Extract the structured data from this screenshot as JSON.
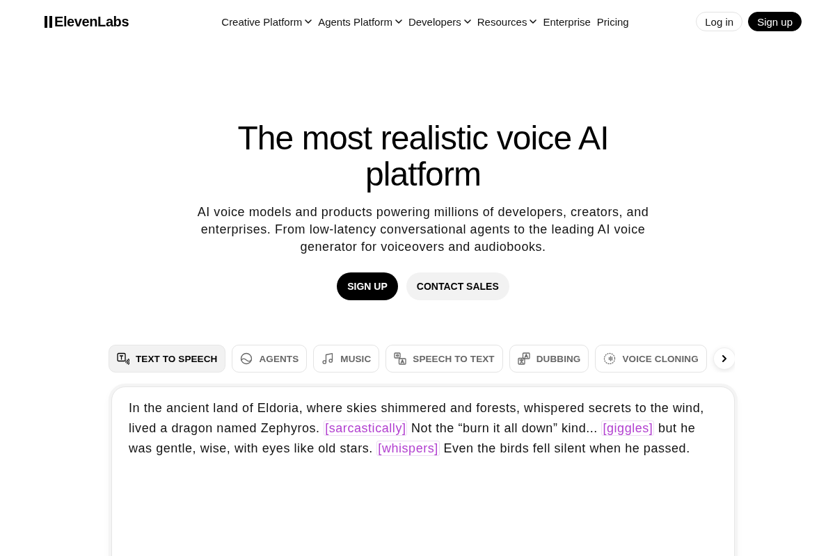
{
  "header": {
    "logo": "ElevenLabs",
    "nav": [
      {
        "label": "Creative Platform",
        "has_menu": true
      },
      {
        "label": "Agents Platform",
        "has_menu": true
      },
      {
        "label": "Developers",
        "has_menu": true
      },
      {
        "label": "Resources",
        "has_menu": true
      },
      {
        "label": "Enterprise",
        "has_menu": false
      },
      {
        "label": "Pricing",
        "has_menu": false
      }
    ],
    "actions": [
      {
        "label": "Log in",
        "kind": "outline"
      },
      {
        "label": "Sign up",
        "kind": "solid"
      }
    ]
  },
  "hero": {
    "title": "The most realistic voice AI platform",
    "subtitle": "AI voice models and products powering millions of developers, creators, and enterprises. From low-latency conversational agents to the leading AI voice generator for voiceovers and audiobooks.",
    "buttons": [
      {
        "label": "SIGN UP",
        "kind": "primary"
      },
      {
        "label": "CONTACT SALES",
        "kind": "secondary"
      }
    ]
  },
  "product_tabs": [
    {
      "label": "TEXT TO SPEECH",
      "selected": true
    },
    {
      "label": "AGENTS",
      "selected": false
    },
    {
      "label": "MUSIC",
      "selected": false
    },
    {
      "label": "SPEECH TO TEXT",
      "selected": false
    },
    {
      "label": "DUBBING",
      "selected": false
    },
    {
      "label": "VOICE CLONING",
      "selected": false
    }
  ],
  "editor": {
    "segments": [
      {
        "kind": "text",
        "text": "In the ancient land of Eldoria, where skies shimmered and forests, whispered secrets to the wind, lived a dragon named Zephyros. "
      },
      {
        "kind": "tag",
        "text": "[sarcastically]"
      },
      {
        "kind": "text",
        "text": " Not the “burn it all down” kind... "
      },
      {
        "kind": "tag",
        "text": "[giggles]"
      },
      {
        "kind": "text",
        "text": " but he was gentle, wise, with eyes like old stars. "
      },
      {
        "kind": "tag",
        "text": "[whispers]"
      },
      {
        "kind": "text",
        "text": " Even the birds fell silent when he passed."
      }
    ]
  }
}
